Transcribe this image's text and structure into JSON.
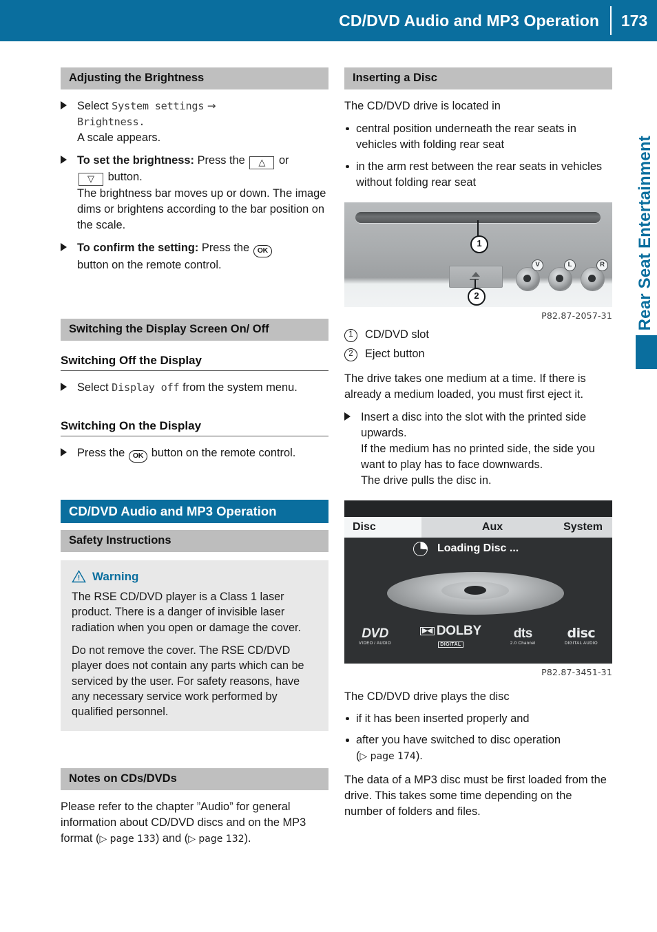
{
  "header": {
    "title": "CD/DVD Audio and MP3 Operation",
    "page_number": "173",
    "bg_color": "#0a6e9e"
  },
  "side_tab": {
    "label": "Rear Seat Entertainment",
    "color": "#0a6e9e"
  },
  "left_column": {
    "section_brightness": {
      "heading": "Adjusting the Brightness",
      "steps": {
        "step1_select": "Select",
        "step1_mono1": "System settings",
        "step1_arrow": "→",
        "step1_mono2": "Brightness.",
        "step1_result": "A scale appears.",
        "step2_bold": "To set the brightness:",
        "step2_text1": "Press the",
        "step2_key_up": "△",
        "step2_or": "or",
        "step2_key_down": "▽",
        "step2_text2": "button.",
        "step2_result": "The brightness bar moves up or down. The image dims or brightens according to the bar position on the scale.",
        "step3_bold": "To confirm the setting:",
        "step3_text1": "Press the",
        "step3_key_ok": "OK",
        "step3_text2": "button on the remote control."
      }
    },
    "section_display": {
      "heading": "Switching the Display Screen On/ Off",
      "sub_off": {
        "heading": "Switching Off the Display",
        "step_pre": "Select",
        "step_mono": "Display off",
        "step_post": "from the system menu."
      },
      "sub_on": {
        "heading": "Switching On the Display",
        "step_pre": "Press the",
        "step_key_ok": "OK",
        "step_post": "button on the remote control."
      }
    },
    "section_cddvd": {
      "heading": "CD/DVD Audio and MP3 Operation",
      "safety": {
        "heading": "Safety Instructions",
        "warning_label": "Warning",
        "warning_p1": "The RSE CD/DVD player is a Class 1 laser product. There is a danger of invisible laser radiation when you open or damage the cover.",
        "warning_p2": "Do not remove the cover. The RSE CD/DVD player does not contain any parts which can be serviced by the user. For safety reasons, have any necessary service work performed by qualified personnel."
      }
    },
    "section_notes": {
      "heading": "Notes on CDs/DVDs",
      "text_1": "Please refer to the chapter ”Audio” for general information about CD/DVD discs and on the MP3 format (",
      "pageref_1": "▷ page 133",
      "text_2": ") and (",
      "pageref_2": "▷ page 132",
      "text_3": ")."
    }
  },
  "right_column": {
    "section_inserting": {
      "heading": "Inserting a Disc",
      "intro": "The CD/DVD drive is located in",
      "bullets": [
        "central position underneath the rear seats in vehicles with folding rear seat",
        "in the arm rest between the rear seats in vehicles without folding rear seat"
      ]
    },
    "figure_drive": {
      "code": "P82.87-2057-31",
      "jack_labels": [
        "V",
        "L",
        "R"
      ],
      "callouts": [
        "1",
        "2"
      ]
    },
    "legend": [
      {
        "num": "1",
        "label": "CD/DVD slot"
      },
      {
        "num": "2",
        "label": "Eject button"
      }
    ],
    "paragraph_drive": "The drive takes one medium at a time. If there is already a medium loaded, you must first eject it.",
    "step_insert": {
      "line1": "Insert a disc into the slot with the printed side upwards.",
      "line2": "If the medium has no printed side, the side you want to play has to face downwards.",
      "line3": "The drive pulls the disc in."
    },
    "figure_loading": {
      "code": "P82.87-3451-31",
      "tabs": [
        "Disc",
        "Aux",
        "System"
      ],
      "status_text": "Loading Disc ...",
      "logos": [
        {
          "big": "DVD",
          "small": "VIDEO / AUDIO"
        },
        {
          "big": "DOLBY",
          "small": "DIGITAL"
        },
        {
          "big": "dts",
          "small": "2.0 Channel"
        },
        {
          "big": "disc",
          "small": "DIGITAL AUDIO"
        }
      ]
    },
    "plays_intro": "The CD/DVD drive plays the disc",
    "plays_bullets": [
      "if it has been inserted properly and",
      "after you have switched to disc operation"
    ],
    "plays_pageref_pre": "(",
    "plays_pageref": "▷ page 174",
    "plays_pageref_post": ").",
    "paragraph_mp3": "The data of a MP3 disc must be first loaded from the drive. This takes some time depending on the number of folders and files."
  }
}
